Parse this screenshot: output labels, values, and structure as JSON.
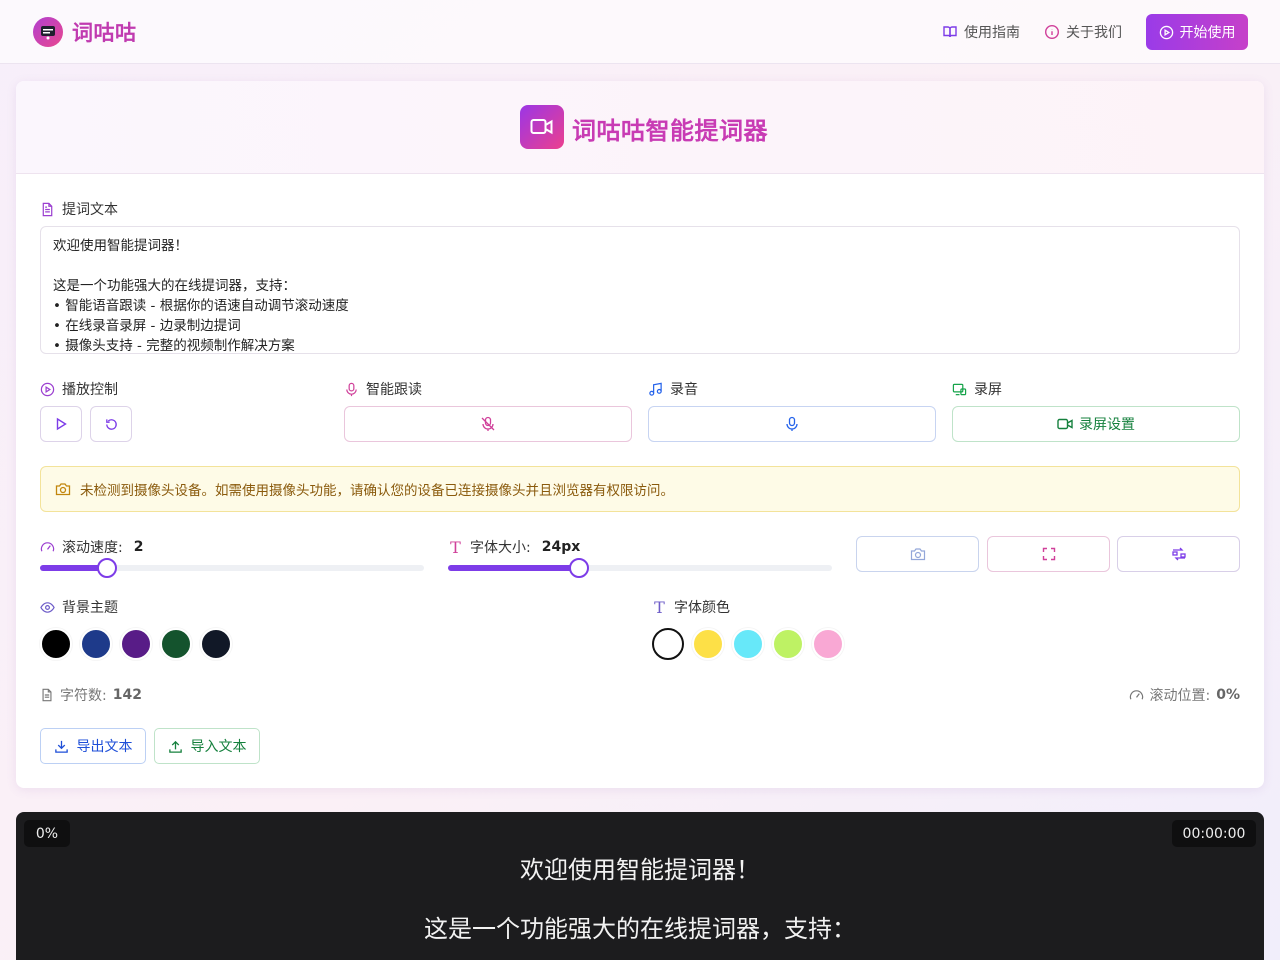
{
  "nav": {
    "brand": "词咕咕",
    "guide": "使用指南",
    "about": "关于我们",
    "start": "开始使用"
  },
  "card": {
    "title": "词咕咕智能提词器",
    "text_label": "提词文本",
    "text_lines": [
      "欢迎使用智能提词器！",
      "",
      "这是一个功能强大的在线提词器，支持：",
      "• 智能语音跟读 - 根据你的语速自动调节滚动速度",
      "• 在线录音录屏 - 边录制边提词",
      "• 摄像头支持 - 完整的视频制作解决方案"
    ],
    "playback_label": "播放控制",
    "follow_label": "智能跟读",
    "record_audio_label": "录音",
    "record_screen_label": "录屏",
    "screen_settings": "录屏设置",
    "camera_alert": "未检测到摄像头设备。如需使用摄像头功能，请确认您的设备已连接摄像头并且浏览器有权限访问。",
    "speed_label": "滚动速度:",
    "speed_value": "2",
    "speed_fraction": 0.175,
    "font_size_label": "字体大小:",
    "font_size_value": "24px",
    "font_size_fraction": 0.34,
    "bg_theme_label": "背景主题",
    "bg_colors": [
      "#000000",
      "#1e3a8a",
      "#581c87",
      "#14532d",
      "#111827"
    ],
    "font_color_label": "字体颜色",
    "font_colors": [
      "#ffffff",
      "#fde047",
      "#67e8f9",
      "#bef264",
      "#f9a8d4"
    ],
    "char_count_label": "字符数:",
    "char_count": "142",
    "scroll_pos_label": "滚动位置:",
    "scroll_pos": "0%",
    "export": "导出文本",
    "import": "导入文本"
  },
  "prompter": {
    "progress": "0%",
    "timer": "00:00:00",
    "lines": [
      "欢迎使用智能提词器！",
      "这是一个功能强大的在线提词器，支持："
    ]
  },
  "colors": {
    "accent": "#7d3ce8",
    "brand_pink": "#c83bb4",
    "green": "#16a34a",
    "blue": "#2563eb"
  }
}
